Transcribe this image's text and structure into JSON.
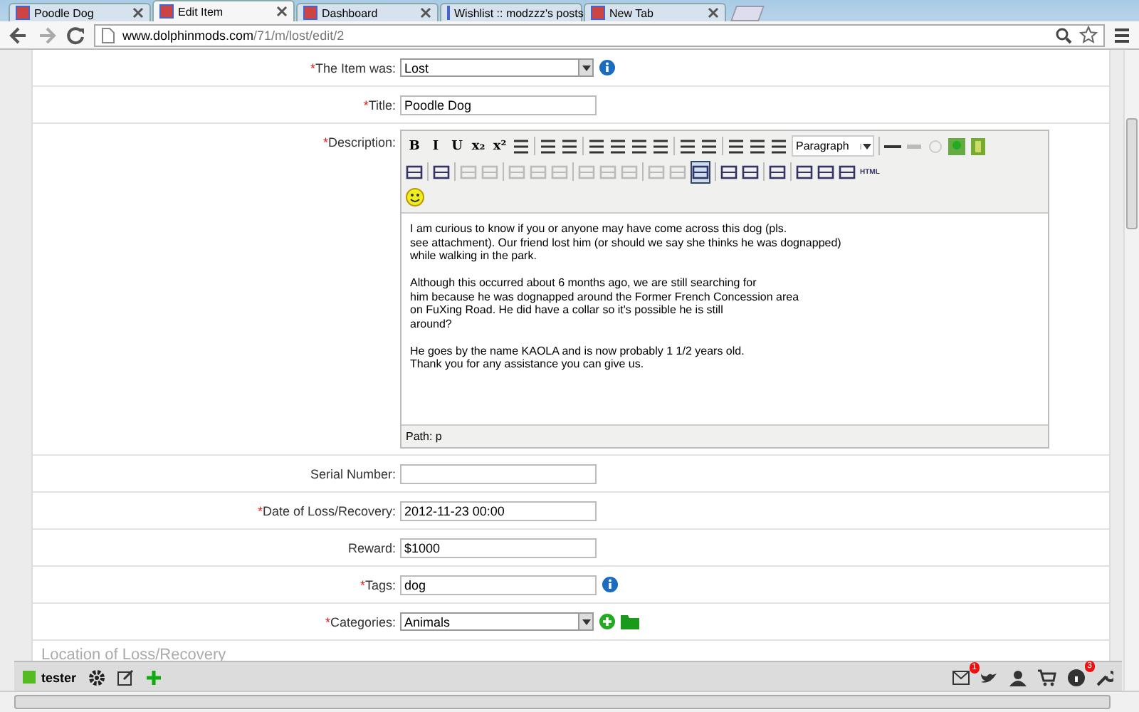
{
  "browser": {
    "tabs": [
      {
        "title": "Poodle Dog",
        "selected": false
      },
      {
        "title": "Edit Item",
        "selected": true
      },
      {
        "title": "Dashboard",
        "selected": false
      },
      {
        "title": "Wishlist :: modzzz's posts",
        "selected": false
      },
      {
        "title": "New Tab",
        "selected": false
      }
    ],
    "url_host": "www.dolphinmods.com",
    "url_path": "/71/m/lost/edit/2"
  },
  "form": {
    "fields": [
      {
        "label": "The Item was:",
        "required": true,
        "kind": "select",
        "value": "Lost",
        "info": true
      },
      {
        "label": "Title:",
        "required": true,
        "kind": "text",
        "value": "Poodle Dog",
        "info": false
      },
      {
        "label": "Description:",
        "required": true,
        "kind": "editor",
        "info": false
      },
      {
        "label": "Serial Number:",
        "required": false,
        "kind": "text",
        "info": false
      },
      {
        "label": "Date of Loss/Recovery:",
        "required": true,
        "kind": "text",
        "value": "2012-11-23 00:00",
        "info": false
      },
      {
        "label": "Reward:",
        "required": false,
        "kind": "text",
        "value": "$1000",
        "info": false
      },
      {
        "label": "Tags:",
        "required": true,
        "kind": "text",
        "value": "dog",
        "info": true
      },
      {
        "label": "Categories:",
        "required": true,
        "kind": "select",
        "value": "Animals",
        "info": false,
        "add": true
      }
    ],
    "required_mark": "*",
    "editor": {
      "text_buttons": [
        "B",
        "I",
        "U",
        "x₂",
        "x²"
      ],
      "format": "Paragraph",
      "html_button": "HTML",
      "paragraphs": [
        [
          "I am curious to know if you or anyone may have come across this dog (pls.",
          "see attachment). Our friend lost him (or should we say she thinks he was dognapped)",
          "while walking in the park."
        ],
        [
          "Although this occurred about 6 months ago, we are still searching for",
          "him because he was dognapped around the Former French Concession area",
          "on FuXing Road. He did have a collar so it's possible he is still",
          "around?"
        ],
        [
          "He goes by the name KAOLA and is now probably 1 1/2 years old.",
          "Thank you for any assistance you can give us."
        ]
      ],
      "path": "Path: p"
    },
    "section_heading": "Location of Loss/Recovery"
  },
  "bottom_bar": {
    "user": "tester",
    "mail_badge": "1",
    "info_badge": "3"
  }
}
